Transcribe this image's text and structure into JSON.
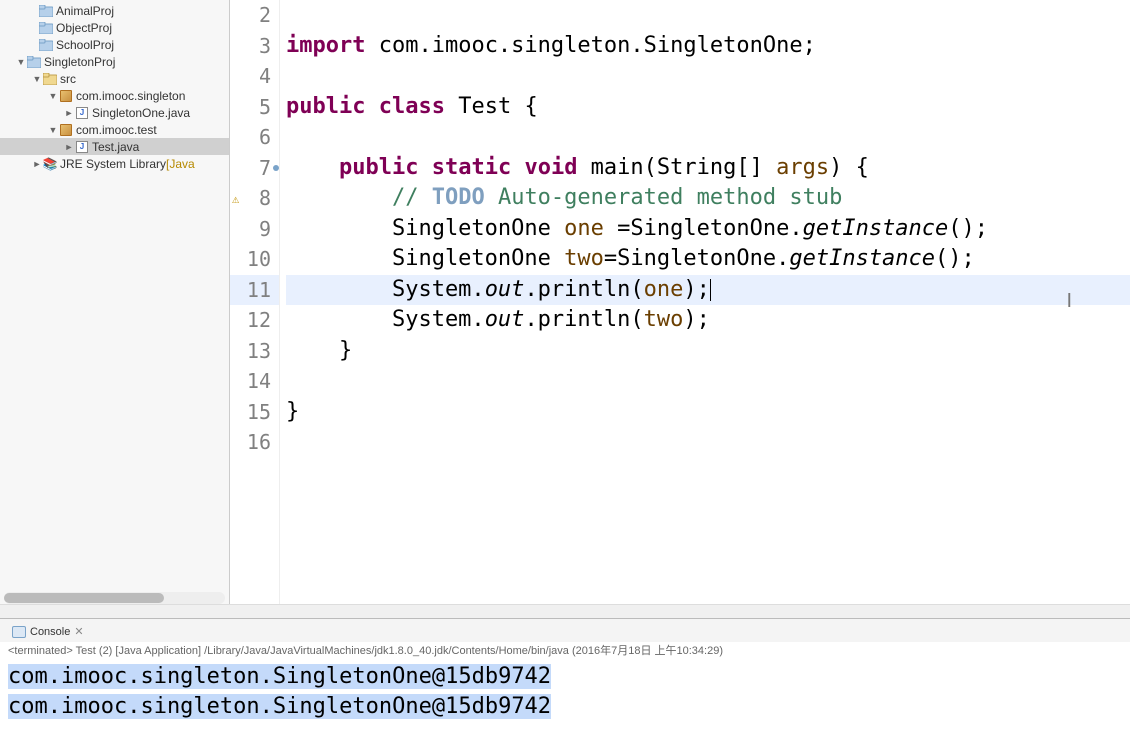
{
  "tree": {
    "items": [
      {
        "indent": 28,
        "arrow": "",
        "iconType": "folder-blue",
        "label": "AnimalProj"
      },
      {
        "indent": 28,
        "arrow": "",
        "iconType": "folder-blue",
        "label": "ObjectProj"
      },
      {
        "indent": 28,
        "arrow": "",
        "iconType": "folder-blue",
        "label": "SchoolProj"
      },
      {
        "indent": 16,
        "arrow": "▼",
        "iconType": "folder-blue",
        "label": "SingletonProj"
      },
      {
        "indent": 32,
        "arrow": "▼",
        "iconType": "src",
        "label": "src"
      },
      {
        "indent": 48,
        "arrow": "▼",
        "iconType": "pkg",
        "label": "com.imooc.singleton"
      },
      {
        "indent": 64,
        "arrow": "►",
        "iconType": "java",
        "label": "SingletonOne.java"
      },
      {
        "indent": 48,
        "arrow": "▼",
        "iconType": "pkg",
        "label": "com.imooc.test"
      },
      {
        "indent": 64,
        "arrow": "►",
        "iconType": "java",
        "label": "Test.java",
        "selected": true
      },
      {
        "indent": 32,
        "arrow": "►",
        "iconType": "lib",
        "label": "JRE System Library",
        "suffix": " [Java"
      }
    ]
  },
  "code": {
    "lines": [
      {
        "n": "2",
        "html": ""
      },
      {
        "n": "3",
        "html": "<span class='kw'>import</span> com.imooc.singleton.SingletonOne;"
      },
      {
        "n": "4",
        "html": ""
      },
      {
        "n": "5",
        "html": "<span class='kw'>public</span> <span class='kw'>class</span> Test {"
      },
      {
        "n": "6",
        "html": ""
      },
      {
        "n": "7",
        "marker": true,
        "html": "    <span class='kw'>public</span> <span class='kw'>static</span> <span class='kw'>void</span> main(String[] <span class='var'>args</span>) {"
      },
      {
        "n": "8",
        "warn": true,
        "html": "        <span class='comment'>// </span><span class='todo'>TODO</span><span class='comment'> Auto-generated method stub</span>"
      },
      {
        "n": "9",
        "html": "        SingletonOne <span class='var'>one</span> =SingletonOne.<span class='italic'>getInstance</span>();"
      },
      {
        "n": "10",
        "html": "        SingletonOne <span class='var'>two</span>=SingletonOne.<span class='italic'>getInstance</span>();"
      },
      {
        "n": "11",
        "active": true,
        "html": "        System.<span class='italic'>out</span>.println(<span class='var'>one</span>);<span class='cursor-beam'></span>"
      },
      {
        "n": "12",
        "html": "        System.<span class='italic'>out</span>.println(<span class='var'>two</span>);"
      },
      {
        "n": "13",
        "html": "    }"
      },
      {
        "n": "14",
        "html": ""
      },
      {
        "n": "15",
        "html": "}"
      },
      {
        "n": "16",
        "html": ""
      }
    ]
  },
  "console": {
    "tab_label": "Console",
    "close_glyph": "✕",
    "status": "<terminated> Test (2) [Java Application] /Library/Java/JavaVirtualMachines/jdk1.8.0_40.jdk/Contents/Home/bin/java (2016年7月18日 上午10:34:29)",
    "output": [
      "com.imooc.singleton.SingletonOne@15db9742",
      "com.imooc.singleton.SingletonOne@15db9742"
    ]
  }
}
